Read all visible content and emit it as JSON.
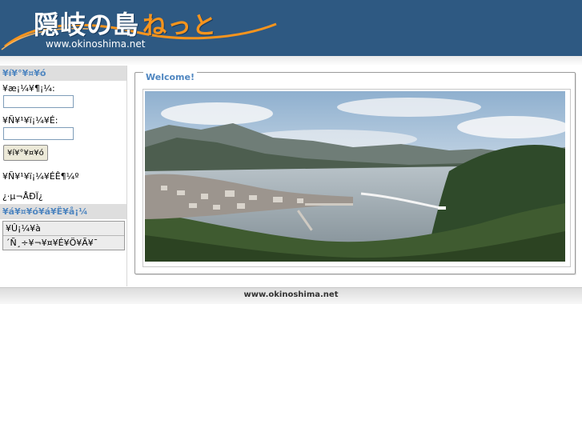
{
  "header": {
    "logo_text_kanji": "隠岐の島",
    "logo_text_kana": "ねっと",
    "logo_url": "www.okinoshima.net"
  },
  "sidebar": {
    "login_heading": "¥í¥°¥¤¥ó",
    "user_label": "¥æ¡¼¥¶¡¼:",
    "user_value": "",
    "password_label": "¥Ñ¥¹¥ï¡¼¥É:",
    "password_value": "",
    "login_button": "¥í¥°¥¤¥ó",
    "forgot_password_link": "¥Ñ¥¹¥ï¡¼¥ÉÊ¶¼º",
    "register_link": "¿·µ¬ÅÐÏ¿",
    "main_menu_heading": "¥á¥¤¥ó¥á¥Ë¥å¡¼",
    "menu_items": [
      {
        "label": "¥Û¡¼¥à"
      },
      {
        "label": "´Ñ¸÷¥¬¥¤¥É¥Ö¥Ã¥¯"
      }
    ]
  },
  "main": {
    "welcome_title": "Welcome!"
  },
  "footer": {
    "text": "www.okinoshima.net"
  },
  "colors": {
    "header_bg": "#2e5982",
    "accent_blue": "#4f86c0",
    "logo_orange": "#f7941d"
  }
}
